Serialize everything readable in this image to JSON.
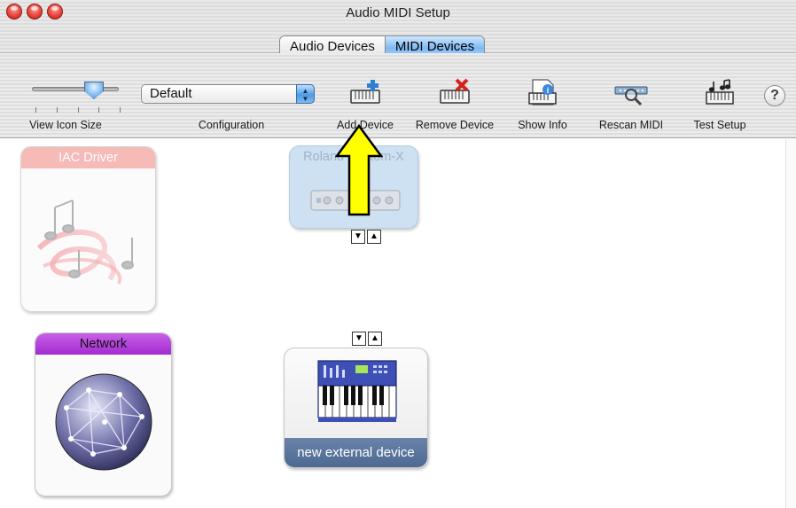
{
  "window": {
    "title": "Audio MIDI Setup"
  },
  "tabs": [
    {
      "label": "Audio Devices",
      "selected": false
    },
    {
      "label": "MIDI Devices",
      "selected": true
    }
  ],
  "toolbar": {
    "view_icon_size_label": "View Icon Size",
    "view_icon_size_value": 0.65,
    "configuration_label": "Configuration",
    "configuration_value": "Default",
    "buttons": [
      {
        "label": "Add Device",
        "icon": "add-device-icon"
      },
      {
        "label": "Remove Device",
        "icon": "remove-device-icon"
      },
      {
        "label": "Show Info",
        "icon": "show-info-icon"
      },
      {
        "label": "Rescan MIDI",
        "icon": "rescan-midi-icon"
      },
      {
        "label": "Test Setup",
        "icon": "test-setup-icon"
      }
    ],
    "help_label": "?"
  },
  "devices": [
    {
      "name": "IAC Driver",
      "icon": "music-notes-icon",
      "color": "#f27f7f",
      "state": "offline"
    },
    {
      "name": "Network",
      "icon": "globe-network-icon",
      "color": "#a32bd0",
      "state": "online"
    },
    {
      "name": "Roland Fantom-X",
      "display_name": "Roland Fantom-X",
      "icon": "midi-interface-icon",
      "color": "#c6dcf0",
      "state": "selected-dimmed"
    },
    {
      "name": "new external device",
      "icon": "keyboard-synth-icon",
      "color": "#4d6a92",
      "state": "online"
    }
  ],
  "port_arrows": {
    "down": "▼",
    "up": "▲"
  },
  "annotation": {
    "icon": "yellow-up-arrow-icon",
    "color": "#ffff00"
  }
}
